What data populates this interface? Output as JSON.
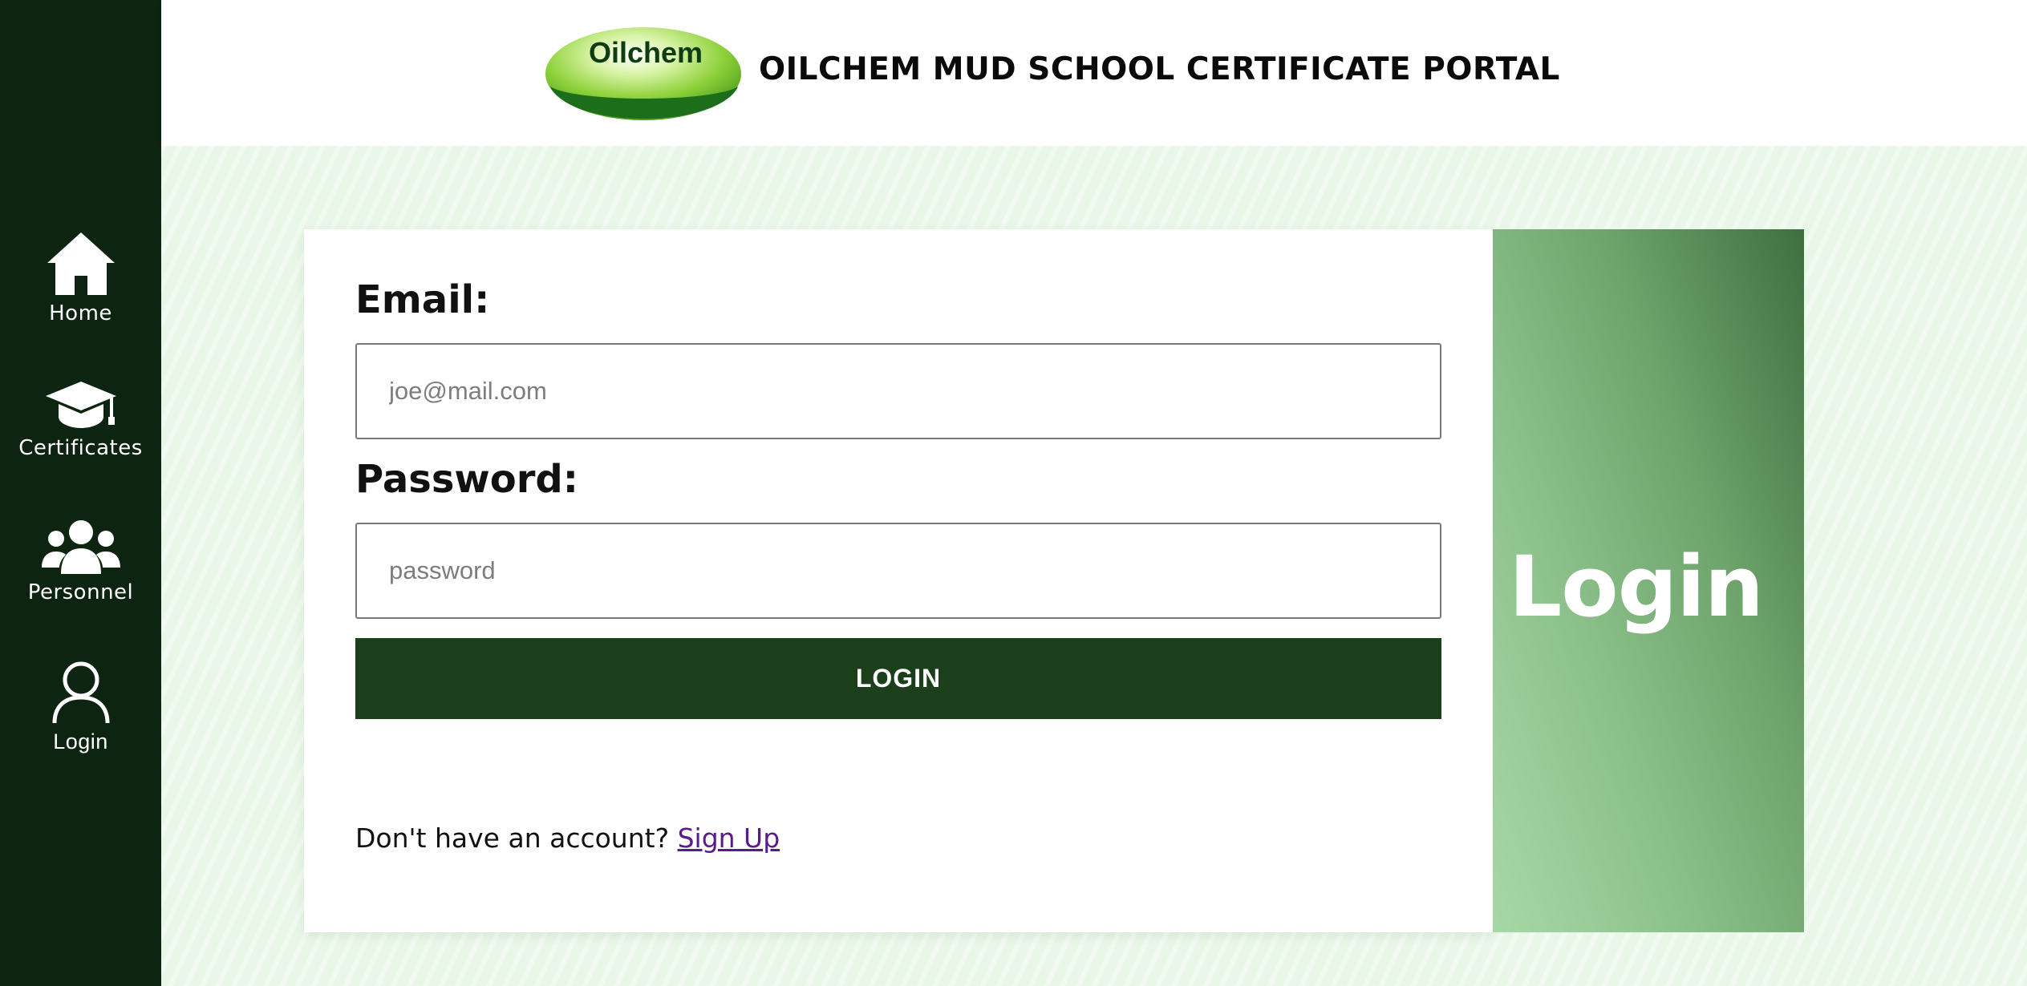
{
  "brand": {
    "logo_text": "Oilchem",
    "title": "OILCHEM MUD SCHOOL CERTIFICATE PORTAL"
  },
  "sidebar": {
    "items": [
      {
        "label": "Home",
        "icon": "home-icon"
      },
      {
        "label": "Certificates",
        "icon": "graduation-cap-icon"
      },
      {
        "label": "Personnel",
        "icon": "users-icon"
      },
      {
        "label": "Login",
        "icon": "user-outline-icon"
      }
    ]
  },
  "form": {
    "email_label": "Email:",
    "email_placeholder": "joe@mail.com",
    "email_value": "",
    "password_label": "Password:",
    "password_placeholder": "password",
    "password_value": "",
    "submit_label": "LOGIN",
    "signup_prompt": "Don't have an account?",
    "signup_link": "Sign Up"
  },
  "panel": {
    "title": "Login"
  },
  "colors": {
    "sidebar_bg": "#0c2410",
    "button_bg": "#1a3f1a",
    "page_bg": "#e9f7e9",
    "link": "#5a1a8a"
  }
}
